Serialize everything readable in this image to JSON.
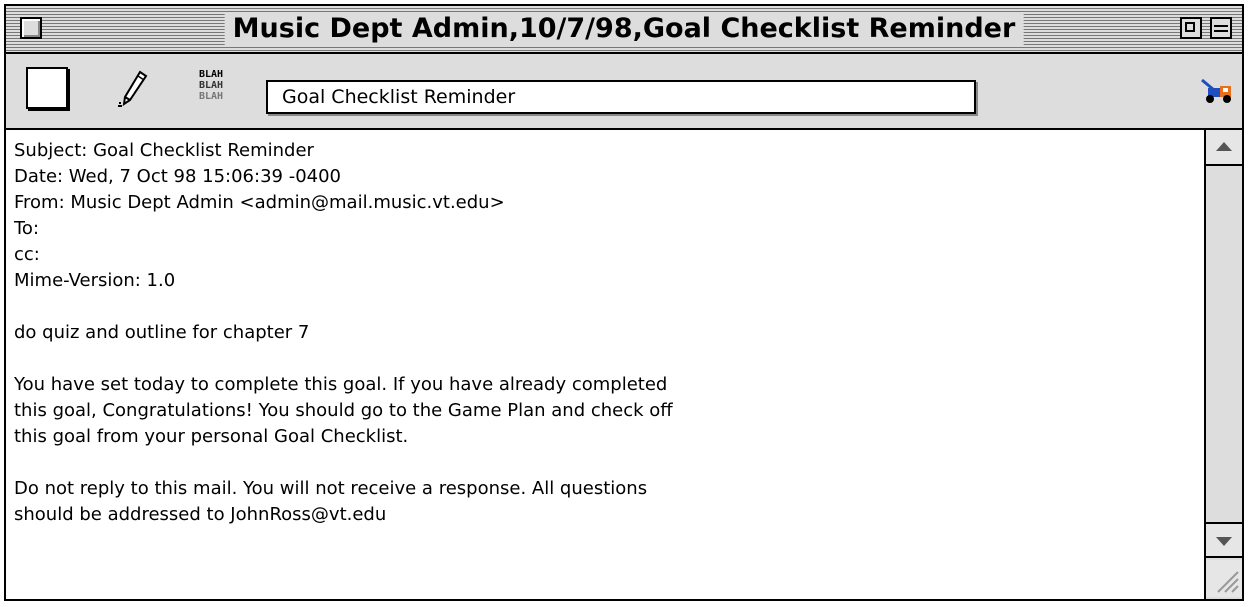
{
  "window": {
    "title": "Music Dept Admin,10/7/98,Goal Checklist Reminder"
  },
  "toolbar": {
    "subject_value": "Goal Checklist Reminder",
    "icons": [
      "blank-button-icon",
      "pencil-icon",
      "blah-blah-icon",
      "tow-truck-icon"
    ]
  },
  "message": {
    "lines": [
      "Subject: Goal Checklist Reminder",
      "Date: Wed, 7 Oct 98 15:06:39 -0400",
      "From: Music Dept Admin <admin@mail.music.vt.edu>",
      "To:",
      "cc:",
      "Mime-Version: 1.0",
      "",
      "do quiz and outline for chapter 7",
      "",
      "You have set today to complete this goal. If you have already completed",
      "this goal, Congratulations! You should go to the Game Plan and check off",
      "this goal from your personal Goal Checklist.",
      "",
      "Do not reply to this mail. You will not receive a response. All questions",
      "should be addressed to JohnRoss@vt.edu"
    ]
  },
  "colors": {
    "window_gray": "#dddddd",
    "border": "#000000",
    "truck_blue": "#1f4fbf",
    "truck_orange": "#e8701a"
  }
}
